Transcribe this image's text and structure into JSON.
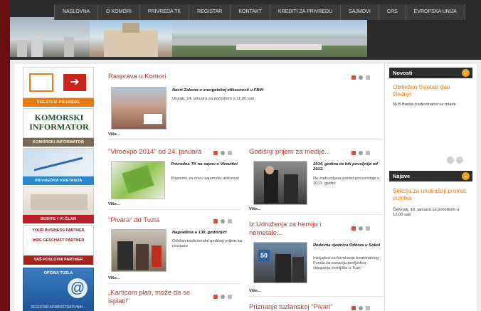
{
  "nav": [
    "NASLOVNA",
    "O KOMORI",
    "PRIVREDA TK",
    "REGISTAR",
    "KONTAKT",
    "KREDITI ZA PRIVREDU",
    "SAJMOVI",
    "CRS",
    "EVROPSKA UNIJA"
  ],
  "colors": {
    "accent_red": "#d72a1e",
    "accent_orange": "#ea7b12",
    "dark_bar": "#2b2b2b",
    "frame_left": "#6a0f10"
  },
  "sidebar": {
    "vijesti": "VIJESTI IZ PRIVREDE",
    "informator_big": "KOMORSKI INFORMATOR",
    "informator": "KOMORSKI INFORMATOR",
    "kretanja": "PRIVREDNA KRETANJA",
    "clan": "BUDITE I VI ČLAN",
    "partner": [
      "YOUR BUSINESS PARTNER",
      "IHRE GESCHÄFT PARTNER",
      "VAŠ POSLOVNI PARTNER"
    ],
    "opcina": "OPĆINA TUZLA",
    "registar": "REGISTAR ADMINISTRATIVNIH..."
  },
  "main": {
    "more": "Više...",
    "s1": {
      "title": "Rasprava u Komori",
      "headline": "Nacrt Zakona o energetskoj efikasnosti u FBiH",
      "desc": "Utorak, 14. januara sa početkom u 11,00 sati"
    },
    "s2": {
      "title": "\"Viroexpo 2014\" od 24. januara",
      "headline": "Privredna TK na sajmu u Virovitici",
      "desc": "Pripreme za novu sajamsku aktivnost"
    },
    "s3": {
      "title": "Godišnji prijem za medije...",
      "headline": "2014. godina će biti povoljnija od 2013.",
      "desc": "Ne zadovoljava porast proizvodnje u 2013. godini"
    },
    "s4": {
      "title": "\"Pivara\" dd Tuzla",
      "headline": "Nagrađena u 130. godišnjici",
      "desc": "Održan tradicionalni godišnji prijem za novinare"
    },
    "s5": {
      "title": "Iz Udruženja za hemiju i nemetale...",
      "headline": "Redovna sjednica Odbora u Sokol",
      "desc": "Inicijativa za formiranje kantonalnog Fonda za sanaciju posljedica slijeganja zemljišta u Tuzli"
    },
    "s6": {
      "title": "„Karticom plati, može da se isplati!\""
    },
    "s7": {
      "title": "Priznanje tuzlanskoj \"Pivari\""
    }
  },
  "right": {
    "news_head": "Novosti",
    "news_title": "Obilježen Svjetski dan štednje",
    "news_text": "NLB Banka tradicionalno uz mlade",
    "events_head": "Najave",
    "events_title": "Sekcija za unutrašnji promet putnika",
    "events_text": "Četvrtak, 16. januara sa početkom u 12,00 sati"
  }
}
